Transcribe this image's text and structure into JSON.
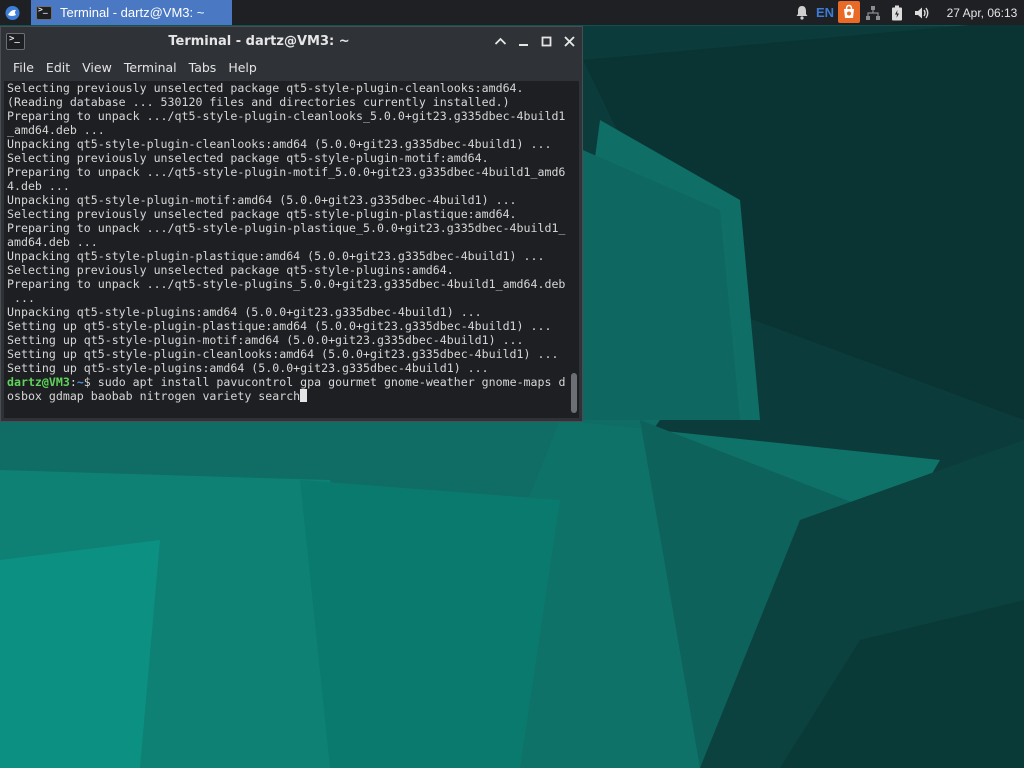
{
  "colors": {
    "panel_bg": "#1e2024",
    "taskbar_active": "#4a78c2",
    "terminal_bg": "#1d1f22",
    "window_bg": "#2f3237",
    "prompt_user": "#5fd35a",
    "prompt_path": "#4d8ede",
    "wallpaper_dark": "#0b3a39",
    "wallpaper_teal": "#0f7d72"
  },
  "panel": {
    "menu_icon": "whisker-menu-icon",
    "task": {
      "label": "Terminal - dartz@VM3: ~",
      "icon": "terminal-icon"
    },
    "tray": {
      "notifications_icon": "bell-icon",
      "keyboard_layout": "EN",
      "updates_icon": "software-updater-icon",
      "network_icon": "network-wired-icon",
      "power_icon": "battery-icon",
      "volume_icon": "speaker-icon"
    },
    "clock": "27 Apr, 06:13"
  },
  "window": {
    "title": "Terminal - dartz@VM3: ~",
    "icon": "terminal-icon",
    "buttons": [
      "minimize-up-icon",
      "minimize-icon",
      "maximize-icon",
      "close-icon"
    ],
    "menu": [
      "File",
      "Edit",
      "View",
      "Terminal",
      "Tabs",
      "Help"
    ]
  },
  "terminal": {
    "output": "Selecting previously unselected package qt5-style-plugin-cleanlooks:amd64.\n(Reading database ... 530120 files and directories currently installed.)\nPreparing to unpack .../qt5-style-plugin-cleanlooks_5.0.0+git23.g335dbec-4build1\n_amd64.deb ...\nUnpacking qt5-style-plugin-cleanlooks:amd64 (5.0.0+git23.g335dbec-4build1) ...\nSelecting previously unselected package qt5-style-plugin-motif:amd64.\nPreparing to unpack .../qt5-style-plugin-motif_5.0.0+git23.g335dbec-4build1_amd6\n4.deb ...\nUnpacking qt5-style-plugin-motif:amd64 (5.0.0+git23.g335dbec-4build1) ...\nSelecting previously unselected package qt5-style-plugin-plastique:amd64.\nPreparing to unpack .../qt5-style-plugin-plastique_5.0.0+git23.g335dbec-4build1_\namd64.deb ...\nUnpacking qt5-style-plugin-plastique:amd64 (5.0.0+git23.g335dbec-4build1) ...\nSelecting previously unselected package qt5-style-plugins:amd64.\nPreparing to unpack .../qt5-style-plugins_5.0.0+git23.g335dbec-4build1_amd64.deb\n ...\nUnpacking qt5-style-plugins:amd64 (5.0.0+git23.g335dbec-4build1) ...\nSetting up qt5-style-plugin-plastique:amd64 (5.0.0+git23.g335dbec-4build1) ...\nSetting up qt5-style-plugin-motif:amd64 (5.0.0+git23.g335dbec-4build1) ...\nSetting up qt5-style-plugin-cleanlooks:amd64 (5.0.0+git23.g335dbec-4build1) ...\nSetting up qt5-style-plugins:amd64 (5.0.0+git23.g335dbec-4build1) ...",
    "prompt_user": "dartz@VM3",
    "prompt_sep": ":",
    "prompt_path": "~",
    "prompt_symbol": "$ ",
    "command_line1": "sudo apt install pavucontrol gpa gourmet gnome-weather gnome-maps d",
    "command_line2": "osbox gdmap baobab nitrogen variety search"
  }
}
